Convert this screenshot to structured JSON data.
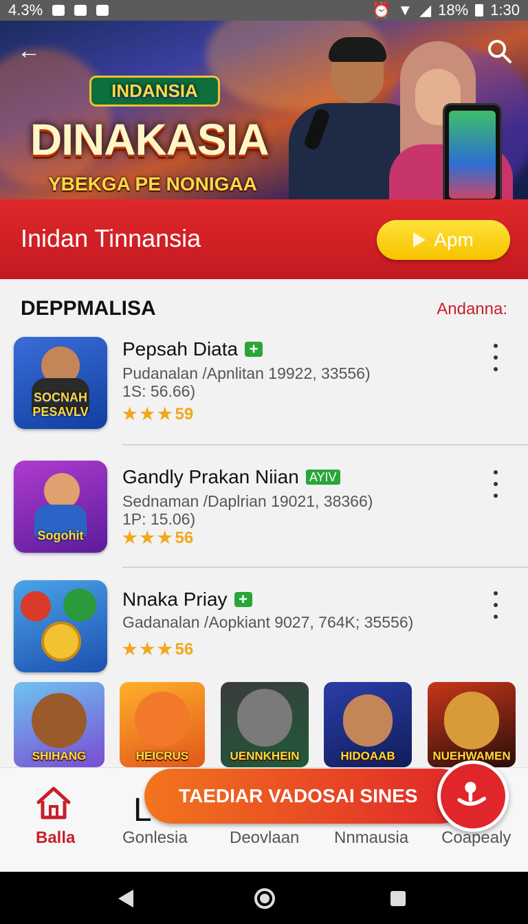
{
  "status_bar": {
    "left_text": "4.3%",
    "battery": "18%",
    "time": "1:30"
  },
  "hero": {
    "logo_small": "INDANSIA",
    "logo_big": "DINAKASIA",
    "tagline": "YBEKGA PE NONIGAA",
    "icons": {
      "back": "back-arrow-icon",
      "search": "search-icon"
    }
  },
  "banner": {
    "title": "Inidan Tinnansia",
    "app_button_label": "Apm"
  },
  "section": {
    "heading": "DEPPMALISA",
    "link": "Andanna:"
  },
  "apps": [
    {
      "title": "Pepsah Diata",
      "badge": "+",
      "meta_line1": "Pudanalan /Apnlitan 19922, 33556)",
      "meta_line2": "1S: 56.66)",
      "rating": "59",
      "stars": 3,
      "thumb_label": "SOCNAH PESAVLV",
      "thumb_colors": [
        "#3b6dd8",
        "#0f3fa0"
      ]
    },
    {
      "title": "Gandly Prakan Niian",
      "badge": "AYIV",
      "meta_line1": "Sednaman /Daplrian 19021, 38366)",
      "meta_line2": "1P: 15.06)",
      "rating": "56",
      "stars": 3,
      "thumb_label": "Sogohit",
      "thumb_colors": [
        "#b03bd0",
        "#5a1c9a"
      ]
    },
    {
      "title": "Nnaka Priay",
      "badge": "+",
      "meta_line1": "Gadanalan /Aopkiant 9027, 764K; 35556)",
      "meta_line2": "",
      "rating": "56",
      "stars": 3,
      "thumb_label": "",
      "thumb_colors": [
        "#4aa4e8",
        "#1c4fb0"
      ]
    }
  ],
  "tiles": [
    {
      "label": "SHIHANG",
      "colors": [
        "#6ec4f0",
        "#7a4bd2"
      ]
    },
    {
      "label": "HEICRUS",
      "colors": [
        "#ffb02a",
        "#e2561a"
      ]
    },
    {
      "label": "UENNKHEIN",
      "colors": [
        "#3b3b3b",
        "#1f5a3a"
      ]
    },
    {
      "label": "HIDOAAB",
      "colors": [
        "#2a3ea8",
        "#111d5a"
      ]
    },
    {
      "label": "NUEHWAMEN",
      "colors": [
        "#c8361a",
        "#2a0e0a"
      ]
    }
  ],
  "promo": {
    "label": "TAEDIAR VADOSAI SINES"
  },
  "bottom_nav": {
    "items": [
      "Balla",
      "Gonlesia",
      "Deovlaan",
      "Nnmausia",
      "Coapealy"
    ],
    "extra_letter": "L"
  },
  "colors": {
    "brand_red": "#d9232a",
    "button_yellow": "#f6c300",
    "badge_green": "#2aa53a",
    "star": "#f2a81a"
  }
}
